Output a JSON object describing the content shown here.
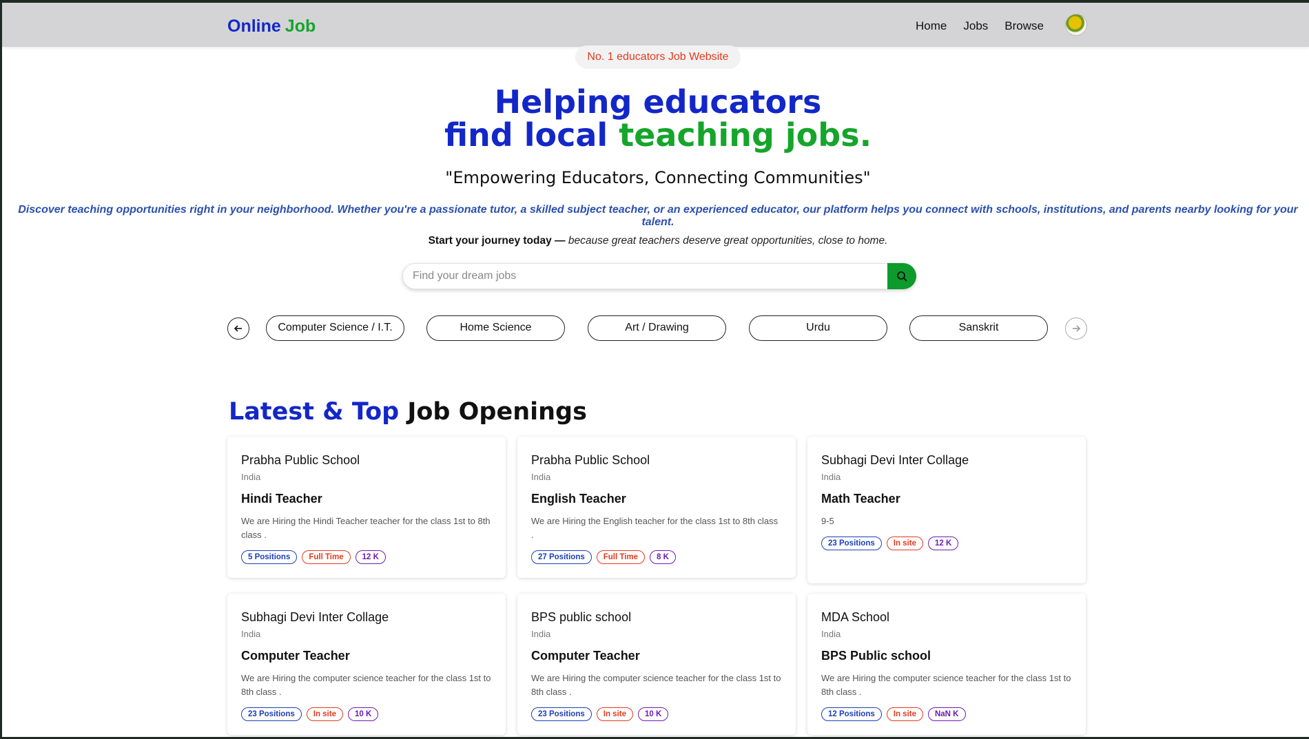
{
  "navbar": {
    "logo_part1": "Online",
    "logo_part2": "Job",
    "links": [
      "Home",
      "Jobs",
      "Browse"
    ]
  },
  "hero": {
    "badge": "No. 1 educators Job Website",
    "title_line1": "Helping educators",
    "title_line2_a": "find local",
    "title_line2_b": "teaching jobs.",
    "quote": "\"Empowering Educators, Connecting Communities\"",
    "description": "Discover teaching opportunities right in your neighborhood. Whether you're a passionate tutor, a skilled subject teacher, or an experienced educator, our platform helps you connect with schools, institutions, and parents nearby looking for your talent.",
    "journey_strong": "Start your journey today —",
    "journey_italic": "because great teachers deserve great opportunities, close to home."
  },
  "search": {
    "placeholder": "Find your dream jobs",
    "value": ""
  },
  "categories": [
    "Computer Science / I.T.",
    "Home Science",
    "Art / Drawing",
    "Urdu",
    "Sanskrit"
  ],
  "section": {
    "title_a": "Latest & Top",
    "title_b": "Job Openings"
  },
  "jobs": [
    {
      "company": "Prabha Public School",
      "location": "India",
      "role": "Hindi Teacher",
      "description": "We are Hiring the Hindi Teacher teacher for the class 1st to 8th class .",
      "positions": "5 Positions",
      "type": "Full Time",
      "salary": "12 K"
    },
    {
      "company": "Prabha Public School",
      "location": "India",
      "role": "English Teacher",
      "description": "We are Hiring the English teacher for the class 1st to 8th class .",
      "positions": "27 Positions",
      "type": "Full Time",
      "salary": "8 K"
    },
    {
      "company": "Subhagi Devi Inter Collage",
      "location": "India",
      "role": "Math Teacher",
      "description": "9-5",
      "positions": "23 Positions",
      "type": "In site",
      "salary": "12 K"
    },
    {
      "company": "Subhagi Devi Inter Collage",
      "location": "India",
      "role": "Computer Teacher",
      "description": "We are Hiring the computer science teacher for the class 1st to 8th class .",
      "positions": "23 Positions",
      "type": "In site",
      "salary": "10 K"
    },
    {
      "company": "BPS public school",
      "location": "India",
      "role": "Computer Teacher",
      "description": "We are Hiring the computer science teacher for the class 1st to 8th class .",
      "positions": "23 Positions",
      "type": "In site",
      "salary": "10 K"
    },
    {
      "company": "MDA School",
      "location": "India",
      "role": "BPS Public school",
      "description": "We are Hiring the computer science teacher for the class 1st to 8th class .",
      "positions": "12 Positions",
      "type": "In site",
      "salary": "NaN K"
    }
  ],
  "colors": {
    "brand_blue": "#1327c8",
    "brand_green": "#15a52b",
    "badge_red": "#e23a1c",
    "tag_purple": "#6d1bb0"
  },
  "icons": [
    "search-icon",
    "arrow-left-icon",
    "arrow-right-icon",
    "avatar"
  ]
}
